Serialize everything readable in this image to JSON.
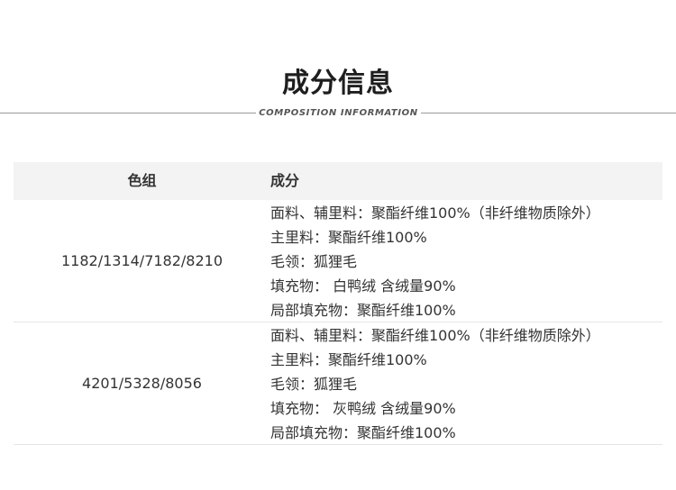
{
  "header": {
    "title": "成分信息",
    "subtitle": "COMPOSITION INFORMATION"
  },
  "table": {
    "columns": [
      "色组",
      "成分"
    ],
    "rows": [
      {
        "color_group": "1182/1314/7182/8210",
        "composition": [
          "面料、辅里料：聚酯纤维100%（非纤维物质除外）",
          "主里料：聚酯纤维100%",
          "毛领：狐狸毛",
          "填充物： 白鸭绒 含绒量90%",
          "局部填充物：聚酯纤维100%"
        ]
      },
      {
        "color_group": "4201/5328/8056",
        "composition": [
          "面料、辅里料：聚酯纤维100%（非纤维物质除外）",
          "主里料：聚酯纤维100%",
          "毛领：狐狸毛",
          "填充物： 灰鸭绒 含绒量90%",
          "局部填充物：聚酯纤维100%"
        ]
      }
    ]
  }
}
